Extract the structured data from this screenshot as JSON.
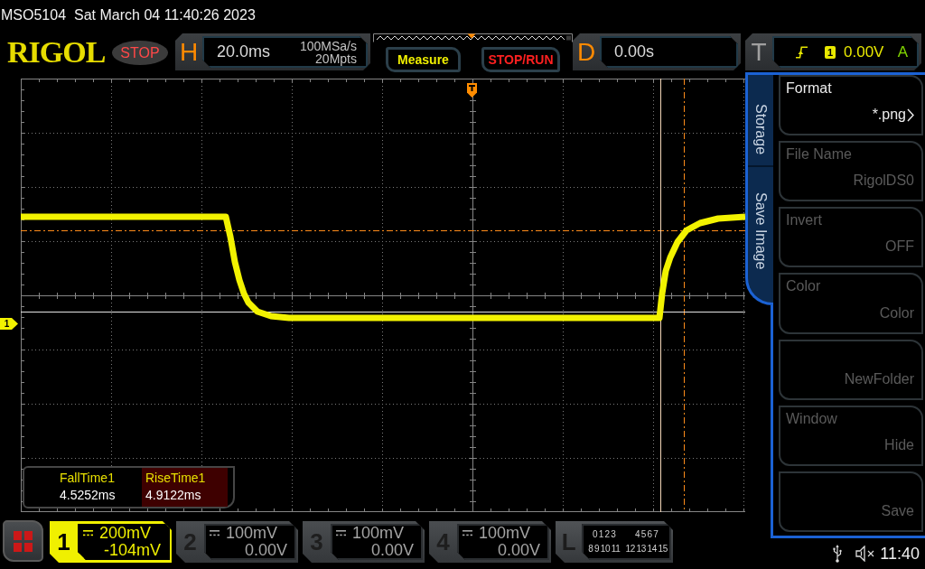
{
  "status_line": {
    "model": "MSO5104",
    "datetime": "Sat March 04 11:40:26 2023"
  },
  "toolbar": {
    "logo": "RIGOL",
    "run_state": "STOP",
    "horizontal": {
      "label": "H",
      "timebase": "20.0ms",
      "sample_rate": "100MSa/s",
      "memory_depth": "20Mpts"
    },
    "buttons": [
      {
        "label": "Measure",
        "kind": "measure"
      },
      {
        "label": "STOP/RUN",
        "kind": "run_stop"
      }
    ],
    "delay": {
      "label": "D",
      "value": "0.00s"
    },
    "trigger": {
      "label": "T",
      "source": "1",
      "level": "0.00V",
      "sweep": "A"
    }
  },
  "display": {
    "channel_marker": "1",
    "measurements": [
      {
        "name": "FallTime1",
        "value": "4.5252ms",
        "selected": false
      },
      {
        "name": "RiseTime1",
        "value": "4.9122ms",
        "selected": true
      }
    ]
  },
  "menu": {
    "title": "Storage",
    "page": "Save Image",
    "softkeys": [
      {
        "label": "Format",
        "value": "*.png",
        "disabled": false,
        "submenu": true
      },
      {
        "label": "File Name",
        "value": "RigolDS0",
        "disabled": true,
        "submenu": false
      },
      {
        "label": "Invert",
        "value": "OFF",
        "disabled": true,
        "submenu": false
      },
      {
        "label": "Color",
        "value": "Color",
        "disabled": true,
        "submenu": false
      },
      {
        "value": "NewFolder",
        "disabled": true,
        "submenu": false
      },
      {
        "label": "Window",
        "value": "Hide",
        "disabled": true,
        "submenu": false
      },
      {
        "value": "Save",
        "disabled": true,
        "submenu": false
      }
    ]
  },
  "channels": [
    {
      "number": "1",
      "scale": "200mV",
      "offset": "-104mV",
      "on": true
    },
    {
      "number": "2",
      "scale": "100mV",
      "offset": "0.00V",
      "on": false
    },
    {
      "number": "3",
      "scale": "100mV",
      "offset": "0.00V",
      "on": false
    },
    {
      "number": "4",
      "scale": "100mV",
      "offset": "0.00V",
      "on": false
    }
  ],
  "logic": {
    "label": "L",
    "groups": [
      "0 1 2 3",
      "4 5 6 7",
      "8 9 10 11",
      "12 13 14 15"
    ]
  },
  "status_bar": {
    "time": "11:40"
  }
}
